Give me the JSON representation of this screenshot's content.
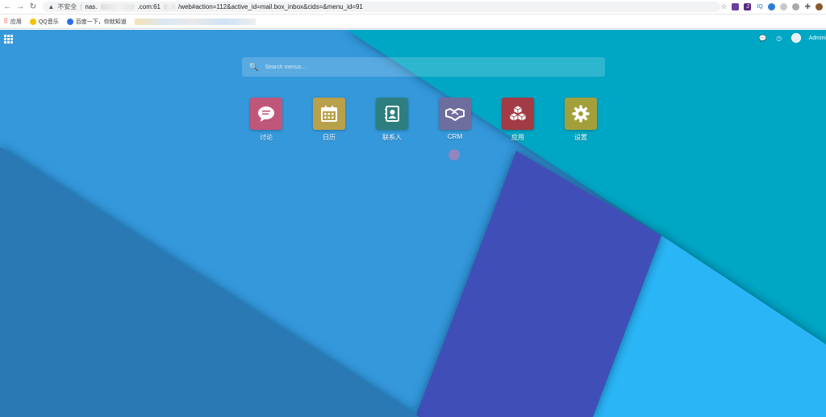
{
  "browser": {
    "security_label": "不安全",
    "url_prefix": "nas.",
    "url_mid": ".com:61",
    "url_suffix": "/web#action=112&active_id=mail.box_inbox&cids=&menu_id=91",
    "bookmarks": [
      {
        "label": "应用",
        "color": "#e8453c"
      },
      {
        "label": "QQ音乐",
        "color": "#f4c20d"
      },
      {
        "label": "百度一下，你就知道",
        "color": "#2d6ee6"
      }
    ],
    "extensions": [
      {
        "label": "",
        "color": "#6b3fa0"
      },
      {
        "label": "J",
        "color": "#5b2a86"
      },
      {
        "label": "IQ",
        "color": "#1a73e8"
      },
      {
        "label": "",
        "color": "#2a7bd4"
      },
      {
        "label": "",
        "color": "#888888"
      },
      {
        "label": "",
        "color": "#888888"
      },
      {
        "label": "",
        "color": "#555555"
      },
      {
        "label": "",
        "color": "#8a5a2b"
      }
    ]
  },
  "app": {
    "user_name": "Admini",
    "search_placeholder": "Search menus...",
    "tiles": [
      {
        "label": "讨论",
        "color": "#c0567a",
        "icon": "chat-bubble-icon"
      },
      {
        "label": "日历",
        "color": "#b9a14b",
        "icon": "calendar-icon"
      },
      {
        "label": "联系人",
        "color": "#2d7f7f",
        "icon": "contact-card-icon"
      },
      {
        "label": "CRM",
        "color": "#6e6e9e",
        "icon": "handshake-icon"
      },
      {
        "label": "应用",
        "color": "#a23b45",
        "icon": "cubes-icon"
      },
      {
        "label": "设置",
        "color": "#a3a03c",
        "icon": "gear-icon"
      }
    ],
    "colors": {
      "bg_main": "#3498db",
      "bg_teal": "#00a7c4",
      "bg_indigo": "#3f4fb8",
      "bg_dark": "#2a78b4",
      "bg_light": "#29b6f6"
    }
  }
}
